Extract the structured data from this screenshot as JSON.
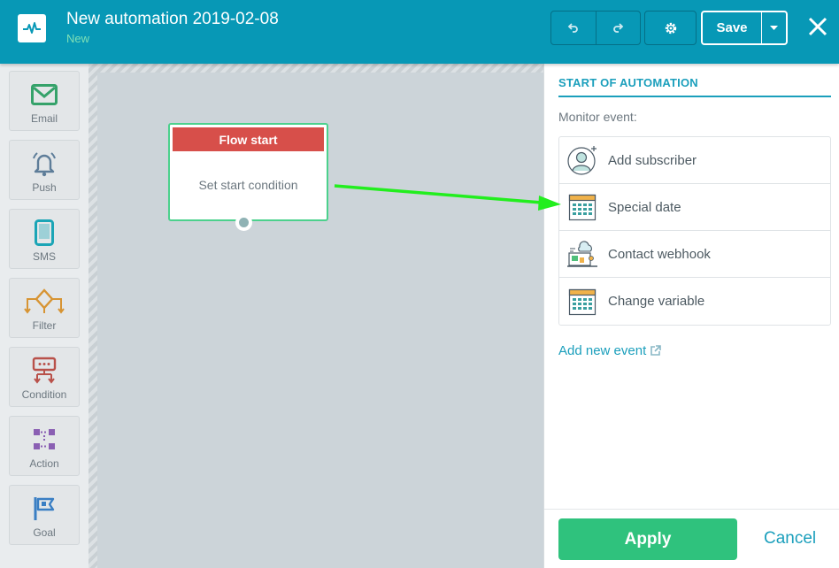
{
  "header": {
    "title": "New automation 2019-02-08",
    "status": "New",
    "save_label": "Save",
    "icons": [
      "pulse-logo-icon",
      "undo-icon",
      "redo-icon",
      "gear-icon",
      "chevron-down-icon",
      "close-icon"
    ]
  },
  "toolbox": {
    "items": [
      {
        "label": "Email",
        "icon": "envelope-icon",
        "color": "#35a26a"
      },
      {
        "label": "Push",
        "icon": "bell-icon",
        "color": "#5e7d99"
      },
      {
        "label": "SMS",
        "icon": "phone-icon",
        "color": "#1ba5b6"
      },
      {
        "label": "Filter",
        "icon": "filter-icon",
        "color": "#d79433"
      },
      {
        "label": "Condition",
        "icon": "condition-icon",
        "color": "#b9514a"
      },
      {
        "label": "Action",
        "icon": "action-icon",
        "color": "#8a5fb3"
      },
      {
        "label": "Goal",
        "icon": "flag-icon",
        "color": "#3a7fc4"
      }
    ]
  },
  "canvas": {
    "node": {
      "title": "Flow start",
      "body": "Set start condition"
    }
  },
  "panel": {
    "title": "START OF AUTOMATION",
    "monitor_label": "Monitor event:",
    "events": [
      {
        "label": "Add subscriber",
        "icon": "add-subscriber-icon"
      },
      {
        "label": "Special date",
        "icon": "calendar-icon"
      },
      {
        "label": "Contact webhook",
        "icon": "webhook-icon"
      },
      {
        "label": "Change variable",
        "icon": "calendar-icon"
      }
    ],
    "add_event_label": "Add new event",
    "apply_label": "Apply",
    "cancel_label": "Cancel"
  },
  "colors": {
    "header": "#0798b6",
    "accent": "#1b9fbc",
    "apply": "#2fc27d",
    "node_header": "#d74f4a",
    "node_border": "#4cd18d",
    "arrow": "#22ee1e"
  }
}
